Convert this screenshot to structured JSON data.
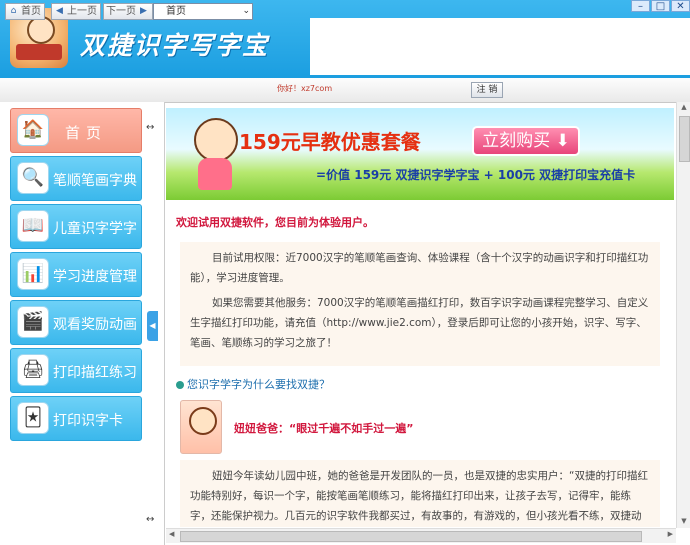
{
  "window": {
    "minimize_icon": "minimize-icon",
    "maximize_icon": "maximize-icon",
    "close_icon": "close-icon"
  },
  "header": {
    "title": "双捷识字写字宝"
  },
  "nav": {
    "home_label": "首页",
    "back_label": "上一页",
    "forward_label": "下一页",
    "current_page": "首页",
    "site_link": "你好！xz7com",
    "logout_label": "注 销"
  },
  "sidebar": {
    "items": [
      {
        "label": "首页",
        "icon": "home-blocks-icon"
      },
      {
        "label": "笔顺笔画字典",
        "icon": "magnifier-icon"
      },
      {
        "label": "儿童识字学字",
        "icon": "book-icon"
      },
      {
        "label": "学习进度管理",
        "icon": "progress-icon"
      },
      {
        "label": "观看奖励动画",
        "icon": "film-icon"
      },
      {
        "label": "打印描红练习",
        "icon": "printer-icon"
      },
      {
        "label": "打印识字卡",
        "icon": "card-icon"
      }
    ]
  },
  "banner": {
    "price_text": "159元早教优惠套餐",
    "buy_label": "立刻购买",
    "sub_text": "=价值 159元 双捷识字学字宝 + 100元 双捷打印宝充值卡"
  },
  "content": {
    "welcome": "欢迎试用双捷软件，您目前为体验用户。",
    "intro_p1": "目前试用权限：近7000汉字的笔顺笔画查询、体验课程（含十个汉字的动画识字和打印描红功能），学习进度管理。",
    "intro_p2": "如果您需要其他服务：7000汉字的笔顺笔画描红打印，数百字识字动画课程完整学习、自定义生字描红打印功能，请充值（http://www.jie2.com），登录后即可让您的小孩开始，识字、写字、笔画、笔顺练习的学习之旅了！",
    "section_heading": "您识字学字为什么要找双捷？",
    "quote": "妞妞爸爸：“眼过千遍不如手过一遍”",
    "story": "妞妞今年读幼儿园中班，她的爸爸是开发团队的一员，也是双捷的忠实用户：“双捷的打印描红功能特别好，每识一个字，能按笔画笔顺练习，能将描红打印出来，让孩子去写，记得牢，能练字，还能保护视力。几百元的识字软件我都买过，有故事的，有游戏的，但小孩光看不练，双捷动画就让小孩更容易记住"
  },
  "colors": {
    "header_blue": "#1b9ee0",
    "menu_blue": "#3bb8ec",
    "menu_active": "#f49a84",
    "accent_red": "#d1173d"
  }
}
